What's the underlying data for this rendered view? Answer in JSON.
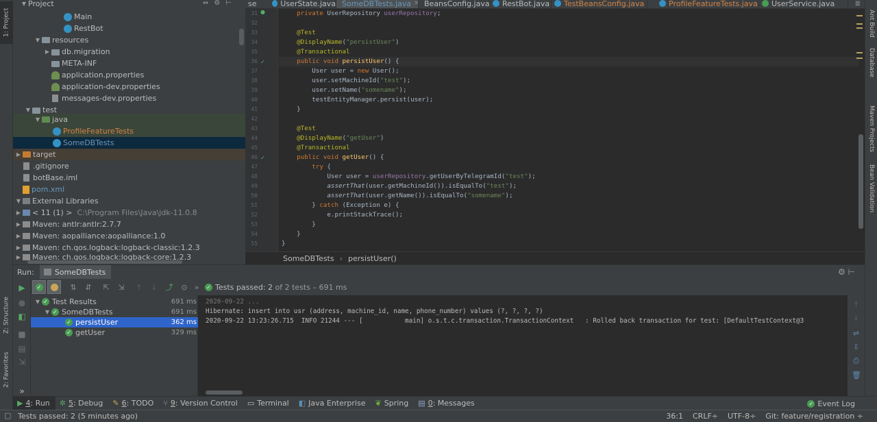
{
  "left_strip": {
    "project": "1: Project",
    "structure": "Z: Structure",
    "favorites": "2: Favorites"
  },
  "right_strip": {
    "ant": "Ant Build",
    "database": "Database",
    "maven": "Maven Projects",
    "bean": "Bean Validation"
  },
  "project_panel": {
    "title": "Project",
    "rows": [
      {
        "label": "Main"
      },
      {
        "label": "RestBot"
      },
      {
        "label": "resources"
      },
      {
        "label": "db.migration"
      },
      {
        "label": "META-INF"
      },
      {
        "label": "application.properties"
      },
      {
        "label": "application-dev.properties"
      },
      {
        "label": "messages-dev.properties"
      },
      {
        "label": "test"
      },
      {
        "label": "java"
      },
      {
        "label": "ProfileFeatureTests"
      },
      {
        "label": "SomeDBTests"
      },
      {
        "label": "target"
      },
      {
        "label": ".gitignore"
      },
      {
        "label": "botBase.iml"
      },
      {
        "label": "pom.xml"
      },
      {
        "label": "External Libraries"
      },
      {
        "label": "< 11 (1) >",
        "extra": "C:\\Program Files\\Java\\jdk-11.0.8"
      },
      {
        "label": "Maven: antlr:antlr:2.7.7"
      },
      {
        "label": "Maven: aopalliance:aopalliance:1.0"
      },
      {
        "label": "Maven: ch.qos.logback:logback-classic:1.2.3"
      },
      {
        "label": "Maven: ch.qos.logback:logback-core:1.2.3"
      }
    ]
  },
  "editor": {
    "tabs": [
      {
        "label": "se"
      },
      {
        "label": "UserState.java"
      },
      {
        "label": "SomeDBTests.java"
      },
      {
        "label": "BeansConfig.java"
      },
      {
        "label": "RestBot.java"
      },
      {
        "label": "TestBeansConfig.java"
      },
      {
        "label": "ProfileFeatureTests.java"
      },
      {
        "label": "UserService.java"
      }
    ],
    "line_numbers": [
      "31",
      "32",
      "33",
      "34",
      "35",
      "36",
      "37",
      "38",
      "39",
      "40",
      "41",
      "42",
      "43",
      "44",
      "45",
      "46",
      "47",
      "48",
      "49",
      "50",
      "51",
      "52",
      "53",
      "54",
      "55"
    ],
    "breadcrumb": {
      "class": "SomeDBTests",
      "method": "persistUser()"
    },
    "code": {
      "l31_kw": "private ",
      "l31_type": "UserRepository ",
      "l31_field": "userRepository",
      "l31_end": ";",
      "l33": "@Test",
      "l34_an": "@DisplayName",
      "l34_a": "(",
      "l34_str": "\"persistUser\"",
      "l34_b": ")",
      "l35": "@Transactional",
      "l36_kw": "public void ",
      "l36_fn": "persistUser",
      "l36_end": "() {",
      "l37_a": "User user = ",
      "l37_kw": "new ",
      "l37_b": "User();",
      "l38_a": "user.setMachineId(",
      "l38_str": "\"test\"",
      "l38_b": ");",
      "l39_a": "user.setName(",
      "l39_str": "\"somename\"",
      "l39_b": ");",
      "l40_a": "testEntityManager.persist(user);",
      "l41": "}",
      "l43": "@Test",
      "l44_an": "@DisplayName",
      "l44_a": "(",
      "l44_str": "\"getUser\"",
      "l44_b": ")",
      "l45": "@Transactional",
      "l46_kw": "public void ",
      "l46_fn": "getUser",
      "l46_end": "() {",
      "l47_kw": "try ",
      "l47_end": "{",
      "l48_a": "User user = ",
      "l48_field": "userRepository",
      "l48_b": ".getUserByTelegramId(",
      "l48_str": "\"test\"",
      "l48_c": ");",
      "l49_it": "assertThat",
      "l49_a": "(user.getMachineId()).isEqualTo(",
      "l49_str": "\"test\"",
      "l49_b": ");",
      "l50_it": "assertThat",
      "l50_a": "(user.getName()).isEqualTo(",
      "l50_str": "\"somename\"",
      "l50_b": ");",
      "l51_a": "} ",
      "l51_kw": "catch ",
      "l51_b": "(Exception e) {",
      "l52": "e.printStackTrace();",
      "l53": "}",
      "l54": "}",
      "l55": "}"
    }
  },
  "run_panel": {
    "label": "Run:",
    "tab": "SomeDBTests",
    "status_prefix": "Tests passed: ",
    "status_count": "2",
    "status_suffix": " of 2 tests – 691 ms",
    "tree": [
      {
        "label": "Test Results",
        "time": "691 ms"
      },
      {
        "label": "SomeDBTests",
        "time": "691 ms"
      },
      {
        "label": "persistUser",
        "time": "362 ms"
      },
      {
        "label": "getUser",
        "time": "329 ms"
      }
    ],
    "console": {
      "line1": "2020-09-22 ...",
      "line2": "Hibernate: insert into usr (address, machine_id, name, phone_number) values (?, ?, ?, ?)",
      "line3": "2020-09-22 13:23:26.715  INFO 21244 --- [           main] o.s.t.c.transaction.TransactionContext   : Rolled back transaction for test: [DefaultTestContext@3"
    }
  },
  "bottom_bar": {
    "run_num": "4",
    "run": ": Run",
    "debug_num": "5",
    "debug": ": Debug",
    "todo_num": "6",
    "todo": ": TODO",
    "vc_num": "9",
    "vc": ": Version Control",
    "terminal": "Terminal",
    "java_ent": "Java Enterprise",
    "spring": "Spring",
    "messages_num": "0",
    "messages": ": Messages",
    "event_log": "Event Log"
  },
  "status_bar": {
    "message": "Tests passed: 2 (5 minutes ago)",
    "position": "36:1",
    "line_sep": "CRLF÷",
    "encoding": "UTF-8÷",
    "git": "Git: feature/registration ÷"
  },
  "colors": {
    "keyword": "#cc7832",
    "annotation": "#bbb529",
    "string": "#6a8759",
    "method": "#ffc66d",
    "field": "#9876aa",
    "selection": "#2f65ca",
    "passed": "#499c54"
  }
}
